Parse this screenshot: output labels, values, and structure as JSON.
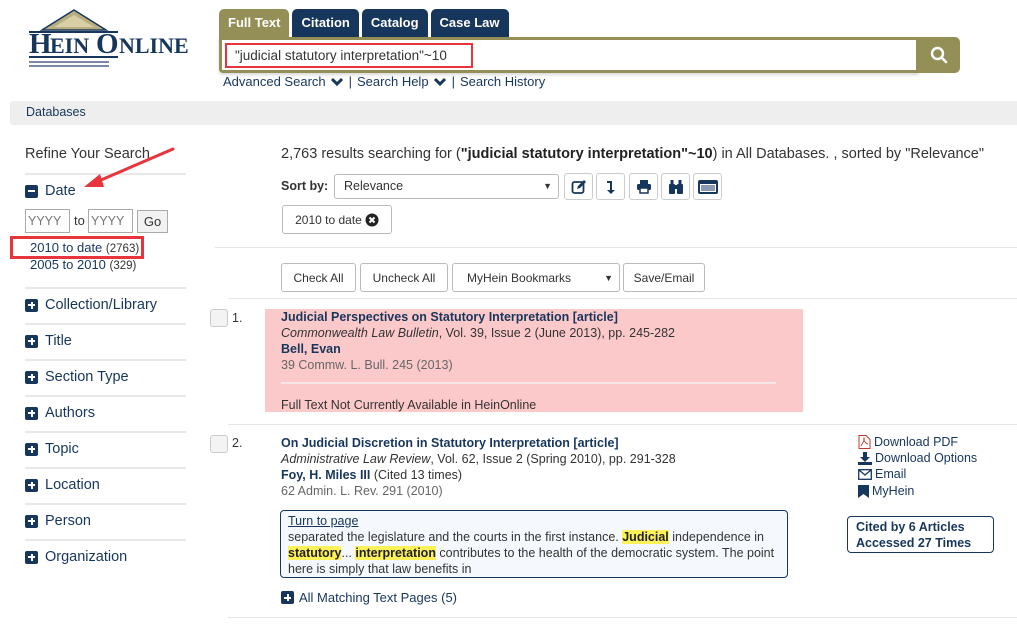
{
  "brand": {
    "logo_text": "HEINONLINE",
    "logo_initial": "H",
    "logo_rest": "EIN",
    "logo_initial2": "O",
    "logo_rest2": "NLINE"
  },
  "search": {
    "tabs": [
      {
        "label": "Full Text",
        "active": true
      },
      {
        "label": "Citation",
        "active": false
      },
      {
        "label": "Catalog",
        "active": false
      },
      {
        "label": "Case Law",
        "active": false
      }
    ],
    "query": "\"judicial statutory interpretation\"~10",
    "search_icon": "magnifier-icon",
    "links": [
      "Advanced Search",
      "Search Help",
      "Search History"
    ]
  },
  "breadcrumb": {
    "label": "Databases"
  },
  "sidebar": {
    "title": "Refine Your Search",
    "date": {
      "label": "Date",
      "from_placeholder": "YYYY",
      "to_label": "to",
      "to_placeholder": "YYYY",
      "go_label": "Go",
      "options": [
        {
          "label": "2010 to date",
          "count": "(2763)"
        },
        {
          "label": "2005 to 2010",
          "count": "(329)"
        }
      ]
    },
    "facets": [
      "Collection/Library",
      "Title",
      "Section Type",
      "Authors",
      "Topic",
      "Location",
      "Person",
      "Organization"
    ]
  },
  "results": {
    "summary_prefix": "2,763 results searching for (",
    "summary_query": "\"judicial statutory interpretation\"~10",
    "summary_suffix": ") in All Databases. , sorted by \"Relevance\"",
    "sort_label": "Sort by:",
    "sort_value": "Relevance",
    "tools": [
      "edit-icon",
      "download-arrow-icon",
      "print-icon",
      "binoculars-icon",
      "list-view-icon"
    ],
    "active_filter": "2010 to date",
    "actions": {
      "check_all": "Check All",
      "uncheck_all": "Uncheck All",
      "bookmarks": "MyHein Bookmarks",
      "save_email": "Save/Email"
    },
    "items": [
      {
        "number": "1.",
        "title": "Judicial Perspectives on Statutory Interpretation [article]",
        "journal": "Commonwealth Law Bulletin",
        "journal_rest": ", Vol. 39, Issue 2 (June 2013), pp. 245-282",
        "author": "Bell, Evan",
        "author_note": "",
        "citation": "39 Commw. L. Bull. 245 (2013)",
        "availability": "Full Text Not Currently Available in HeinOnline"
      },
      {
        "number": "2.",
        "title": "On Judicial Discretion in Statutory Interpretation [article]",
        "journal": "Administrative Law Review",
        "journal_rest": ", Vol. 62, Issue 2 (Spring 2010), pp. 291-328",
        "author": "Foy, H. Miles III",
        "author_note": " (Cited 13 times)",
        "citation": "62 Admin. L. Rev. 291 (2010)",
        "snippet": {
          "turn_to_page": "Turn to page",
          "t1": "separated the legislature and the courts in the first instance. ",
          "h1": "Judicial",
          "t2": " independence in ",
          "h2": "statutory",
          "t3": "... ",
          "h3": "interpretation",
          "t4": " contributes to the health of the democratic system. The point here is simply that law benefits in"
        },
        "more_pages": "All Matching Text Pages (5)",
        "links": {
          "pdf": "Download PDF",
          "options": "Download Options",
          "email": "Email",
          "myhein": "MyHein"
        },
        "cited_by": "Cited by 6 Articles",
        "accessed": "Accessed 27 Times"
      }
    ]
  },
  "colors": {
    "navy": "#17365c",
    "olive": "#948f57",
    "highlight": "#fdf25a",
    "unavailable_bg": "#fcc9ca",
    "annotation_red": "#e8343c"
  }
}
